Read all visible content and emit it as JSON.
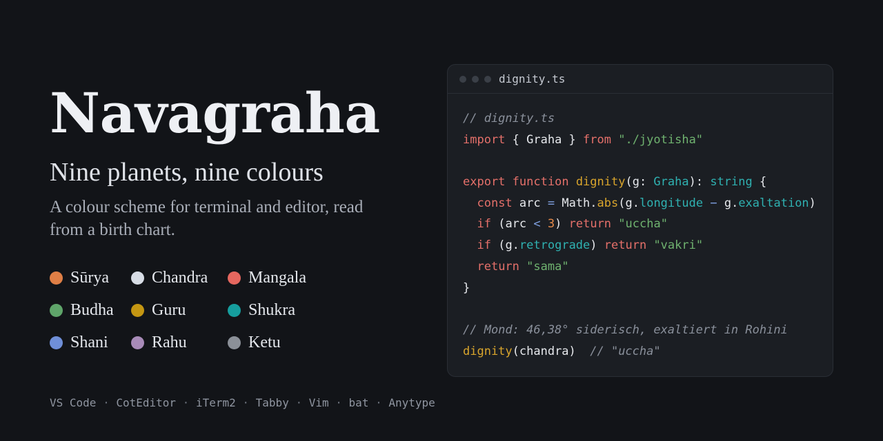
{
  "hero": {
    "title": "Navagraha",
    "subtitle": "Nine planets, nine colours",
    "tagline": "A colour scheme for terminal and editor, read from a birth chart."
  },
  "planets": [
    {
      "name": "Sūrya",
      "color": "#df7f46"
    },
    {
      "name": "Chandra",
      "color": "#d8dde6"
    },
    {
      "name": "Mangala",
      "color": "#e5675f"
    },
    {
      "name": "Budha",
      "color": "#5fa56a"
    },
    {
      "name": "Guru",
      "color": "#c49612"
    },
    {
      "name": "Shukra",
      "color": "#169e9e"
    },
    {
      "name": "Shani",
      "color": "#6f8fd8"
    },
    {
      "name": "Rahu",
      "color": "#a88bb8"
    },
    {
      "name": "Ketu",
      "color": "#8b9098"
    }
  ],
  "supported": {
    "apps": [
      "VS Code",
      "CotEditor",
      "iTerm2",
      "Tabby",
      "Vim",
      "bat",
      "Anytype"
    ],
    "separator": "·"
  },
  "editor": {
    "filename": "dignity.ts",
    "code_lines": [
      [
        {
          "t": "comment",
          "s": "// dignity.ts"
        }
      ],
      [
        {
          "t": "kw",
          "s": "import"
        },
        {
          "t": "plain",
          "s": " { Graha } "
        },
        {
          "t": "kw",
          "s": "from"
        },
        {
          "t": "plain",
          "s": " "
        },
        {
          "t": "str",
          "s": "\"./jyotisha\""
        }
      ],
      [],
      [
        {
          "t": "kw",
          "s": "export"
        },
        {
          "t": "plain",
          "s": " "
        },
        {
          "t": "kw",
          "s": "function"
        },
        {
          "t": "plain",
          "s": " "
        },
        {
          "t": "fn",
          "s": "dignity"
        },
        {
          "t": "plain",
          "s": "(g: "
        },
        {
          "t": "type",
          "s": "Graha"
        },
        {
          "t": "plain",
          "s": "): "
        },
        {
          "t": "type",
          "s": "string"
        },
        {
          "t": "plain",
          "s": " {"
        }
      ],
      [
        {
          "t": "plain",
          "s": "  "
        },
        {
          "t": "kw",
          "s": "const"
        },
        {
          "t": "plain",
          "s": " arc "
        },
        {
          "t": "op",
          "s": "="
        },
        {
          "t": "plain",
          "s": " Math."
        },
        {
          "t": "fn",
          "s": "abs"
        },
        {
          "t": "plain",
          "s": "(g."
        },
        {
          "t": "prop",
          "s": "longitude"
        },
        {
          "t": "plain",
          "s": " "
        },
        {
          "t": "op",
          "s": "−"
        },
        {
          "t": "plain",
          "s": " g."
        },
        {
          "t": "prop",
          "s": "exaltation"
        },
        {
          "t": "plain",
          "s": ")"
        }
      ],
      [
        {
          "t": "plain",
          "s": "  "
        },
        {
          "t": "kw",
          "s": "if"
        },
        {
          "t": "plain",
          "s": " (arc "
        },
        {
          "t": "op",
          "s": "<"
        },
        {
          "t": "plain",
          "s": " "
        },
        {
          "t": "num",
          "s": "3"
        },
        {
          "t": "plain",
          "s": ") "
        },
        {
          "t": "kw",
          "s": "return"
        },
        {
          "t": "plain",
          "s": " "
        },
        {
          "t": "str",
          "s": "\"uccha\""
        }
      ],
      [
        {
          "t": "plain",
          "s": "  "
        },
        {
          "t": "kw",
          "s": "if"
        },
        {
          "t": "plain",
          "s": " (g."
        },
        {
          "t": "prop",
          "s": "retrograde"
        },
        {
          "t": "plain",
          "s": ") "
        },
        {
          "t": "kw",
          "s": "return"
        },
        {
          "t": "plain",
          "s": " "
        },
        {
          "t": "str",
          "s": "\"vakri\""
        }
      ],
      [
        {
          "t": "plain",
          "s": "  "
        },
        {
          "t": "kw",
          "s": "return"
        },
        {
          "t": "plain",
          "s": " "
        },
        {
          "t": "str",
          "s": "\"sama\""
        }
      ],
      [
        {
          "t": "plain",
          "s": "}"
        }
      ],
      [],
      [
        {
          "t": "comment",
          "s": "// Mond: 46,38° siderisch, exaltiert in Rohini"
        }
      ],
      [
        {
          "t": "fn",
          "s": "dignity"
        },
        {
          "t": "plain",
          "s": "(chandra)  "
        },
        {
          "t": "comment",
          "s": "// \"uccha\""
        }
      ]
    ]
  }
}
